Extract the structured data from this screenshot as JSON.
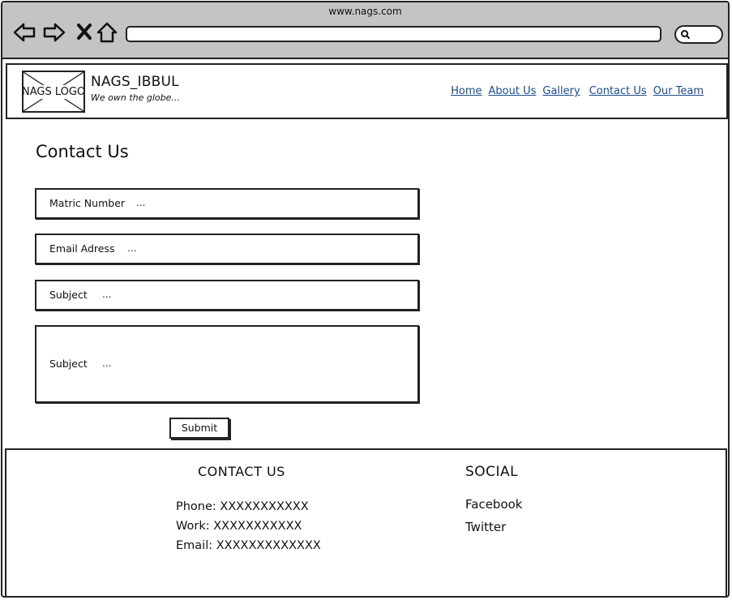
{
  "browser": {
    "url_title": "www.nags.com",
    "nav_icons": [
      "back-arrow-icon",
      "forward-arrow-icon",
      "close-icon",
      "home-icon"
    ],
    "search_icon": "search-icon"
  },
  "header": {
    "logo_text": "NAGS LOGO",
    "site_name": "NAGS_IBBUL",
    "tagline": "We own the globe...",
    "nav": [
      "Home",
      "About Us",
      "Gallery",
      "Contact Us",
      "Our Team"
    ],
    "link_color": "#1b4b8a"
  },
  "main": {
    "title": "Contact Us",
    "fields": [
      {
        "label": "Matric Number",
        "placeholder": "..."
      },
      {
        "label": "Email Adress",
        "placeholder": "..."
      },
      {
        "label": "Subject",
        "placeholder": "..."
      },
      {
        "label": "Subject",
        "placeholder": "..."
      }
    ],
    "submit_label": "Submit"
  },
  "footer": {
    "contact_heading": "CONTACT US",
    "contact_lines": [
      "Phone: XXXXXXXXXXX",
      "Work: XXXXXXXXXXX",
      "Email: XXXXXXXXXXXXX"
    ],
    "social_heading": "SOCIAL",
    "social_links": [
      "Facebook",
      "Twitter"
    ]
  }
}
